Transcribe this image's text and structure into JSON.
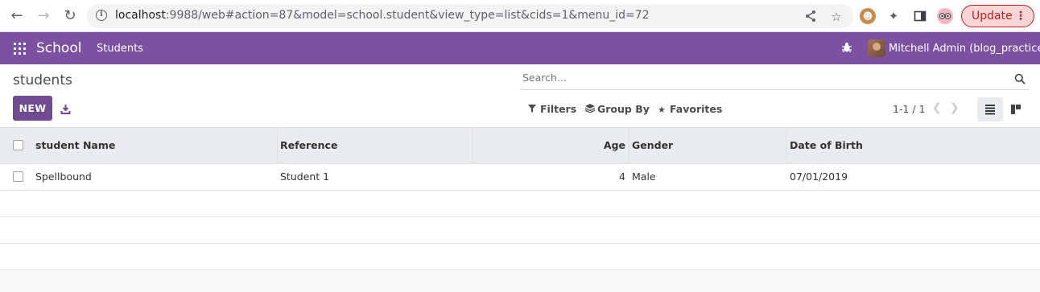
{
  "browser": {
    "url_host": "localhost",
    "url_rest": ":9988/web#action=87&model=school.student&view_type=list&cids=1&menu_id=72",
    "update_label": "Update"
  },
  "topnav": {
    "app_name": "School",
    "menu_students": "Students",
    "user": "Mitchell Admin (blog_practice)"
  },
  "control_panel": {
    "title": "students",
    "search_placeholder": "Search...",
    "new_label": "NEW",
    "filters_label": "Filters",
    "groupby_label": "Group By",
    "favorites_label": "Favorites",
    "pager": "1-1 / 1"
  },
  "table": {
    "columns": [
      "student Name",
      "Reference",
      "Age",
      "Gender",
      "Date of Birth"
    ],
    "rows": [
      {
        "name": "Spellbound",
        "reference": "Student 1",
        "age": "4",
        "gender": "Male",
        "dob": "07/01/2019"
      }
    ]
  },
  "colors": {
    "odoo_purple": "#7c51a1",
    "primary_button": "#714b92",
    "update_red": "#c5221f"
  }
}
